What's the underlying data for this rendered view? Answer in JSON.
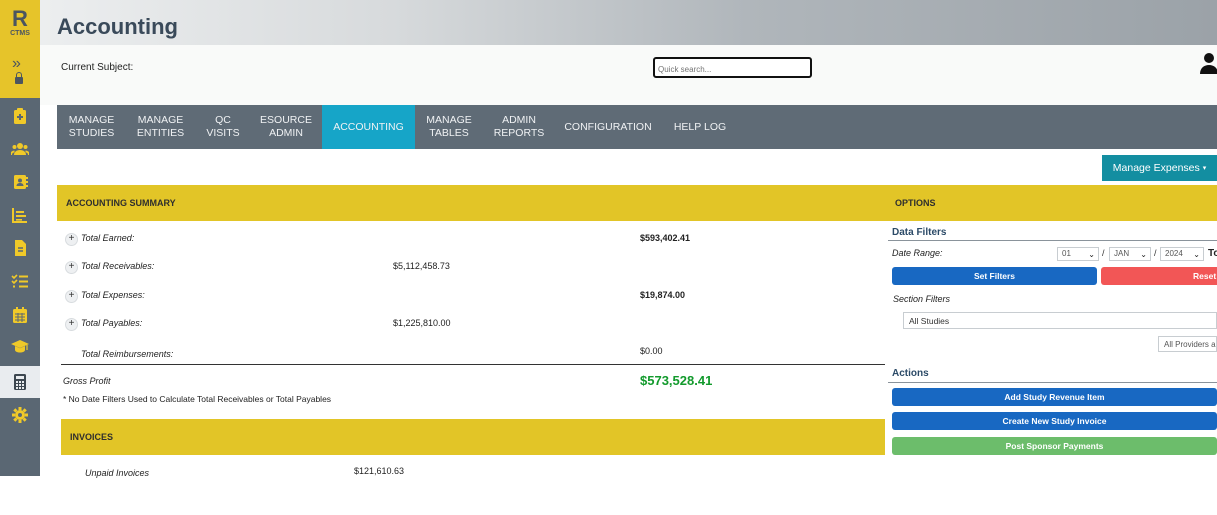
{
  "app": {
    "logo_letter": "R",
    "logo_text": "CTMS",
    "expand_glyph": "»"
  },
  "page": {
    "title": "Accounting"
  },
  "subject": {
    "label": "Current Subject:"
  },
  "search": {
    "placeholder": "Quick search..."
  },
  "nav": {
    "items": [
      {
        "line1": "MANAGE",
        "line2": "STUDIES"
      },
      {
        "line1": "MANAGE",
        "line2": "ENTITIES"
      },
      {
        "line1": "QC",
        "line2": "VISITS"
      },
      {
        "line1": "ESOURCE",
        "line2": "ADMIN"
      },
      {
        "line1": "ACCOUNTING",
        "line2": ""
      },
      {
        "line1": "MANAGE",
        "line2": "TABLES"
      },
      {
        "line1": "ADMIN",
        "line2": "REPORTS"
      },
      {
        "line1": "CONFIGURATION",
        "line2": ""
      },
      {
        "line1": "HELP LOG",
        "line2": ""
      }
    ]
  },
  "manage_expenses": {
    "label": "Manage Expenses",
    "caret": "▾"
  },
  "summary": {
    "heading": "ACCOUNTING SUMMARY",
    "rows": [
      {
        "label": "Total Earned:",
        "receivable_value": "",
        "value": "$593,402.41"
      },
      {
        "label": "Total Receivables:",
        "receivable_value": "$5,112,458.73",
        "value": ""
      },
      {
        "label": "Total Expenses:",
        "receivable_value": "",
        "value": "$19,874.00"
      },
      {
        "label": "Total Payables:",
        "receivable_value": "$1,225,810.00",
        "value": ""
      },
      {
        "label": "Total Reimbursements:",
        "receivable_value": "",
        "value": "$0.00"
      }
    ],
    "gross_profit_label": "Gross Profit",
    "gross_profit_value": "$573,528.41",
    "note": "* No Date Filters Used to Calculate Total Receivables or Total Payables"
  },
  "invoices": {
    "heading": "INVOICES",
    "unpaid_label": "Unpaid Invoices",
    "unpaid_value": "$121,610.63"
  },
  "options": {
    "heading": "OPTIONS",
    "data_filters_title": "Data Filters",
    "date_range_label": "Date Range:",
    "day": "01",
    "month": "JAN",
    "year": "2024",
    "separator": "/",
    "to_label": "To",
    "set_filters": "Set Filters",
    "reset": "Reset",
    "section_filters_label": "Section Filters",
    "studies_select": "All Studies",
    "providers_select": "All Providers and",
    "actions_title": "Actions",
    "actions": [
      {
        "label": "Add Study Revenue Item"
      },
      {
        "label": "Create New Study Invoice"
      },
      {
        "label": "Post Sponsor Payments"
      }
    ]
  },
  "colors": {
    "accent_yellow": "#e2c527",
    "nav_active": "#16a5c8",
    "profit_green": "#129a2c",
    "button_blue": "#1868c2",
    "button_red": "#f25656",
    "button_green": "#6cbd6b"
  }
}
